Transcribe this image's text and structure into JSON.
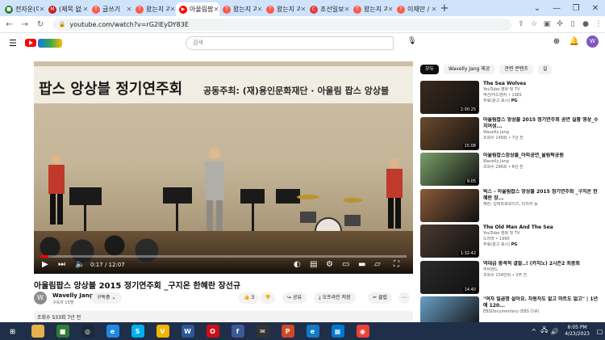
{
  "browser": {
    "tabs": [
      {
        "label": "전자운(이",
        "color": "#2e7d32",
        "glyph": "■"
      },
      {
        "label": "(제목 없음",
        "color": "#c5221f",
        "glyph": "M"
      },
      {
        "label": "글쓰기",
        "color": "#ff5a4a",
        "glyph": "T"
      },
      {
        "label": "왔는지 과",
        "color": "#ff5a4a",
        "glyph": "T"
      },
      {
        "label": "아울림팝",
        "color": "#ff0000",
        "glyph": "▶"
      },
      {
        "label": "왔는지 과",
        "color": "#ff5a4a",
        "glyph": "T"
      },
      {
        "label": "왔는지 과",
        "color": "#ff5a4a",
        "glyph": "T"
      },
      {
        "label": "조선일보",
        "color": "#e53935",
        "glyph": "C"
      },
      {
        "label": "왔는지 과",
        "color": "#ff5a4a",
        "glyph": "T"
      },
      {
        "label": "이재만 /",
        "color": "#ff5a4a",
        "glyph": "T"
      }
    ],
    "url": "youtube.com/watch?v=rG2lEyDY83E"
  },
  "youtube": {
    "search_placeholder": "검색",
    "avatar_letter": "W"
  },
  "player": {
    "banner_title": "팝스 앙상블 정기연주회",
    "banner_sub": "공동주최: (재)용인문화재단 · 아울림 팝스 앙상블",
    "time": "0:17 / 12:07",
    "progress": 0.023
  },
  "video": {
    "title": "아울림팝스 앙상블 2015 정기연주회 _구지온 한혜란 장선규",
    "channel": "Wavelly Jang",
    "channel_initial": "W",
    "subs": "구독자 15명",
    "subscribe": "구독중 ⌄",
    "likes": "3",
    "share": "공유",
    "offline": "오프라인 저장",
    "clip": "클립",
    "views": "조회수 533회  7년 전"
  },
  "sidebar": {
    "chips": [
      "모두",
      "Wavelly Jang 제공",
      "관련 콘텐츠",
      "실"
    ],
    "recs": [
      {
        "title": "The Sea Wolves",
        "channel": "YouTube 영화 및 TV",
        "meta": "액션/어드벤처 • 1981",
        "free": "무료(광고 표시)",
        "rating": "PG",
        "duration": "2:00:25",
        "thumb": "#3a2a1e"
      },
      {
        "title": "아울림팝스 앙상블 2015 정기연주회 공연 실황 영상_수지여성...",
        "channel": "Wavelly Jang",
        "meta": "조회수 149회 • 7년 전",
        "duration": "15:08",
        "thumb": "#6b4a2e"
      },
      {
        "title": "아울림팝스앙상블_아외공연_울림팍공원",
        "channel": "Wavelly Jang",
        "meta": "조회수 286회 • 8년 전",
        "duration": "9:05",
        "thumb": "#7aa06a"
      },
      {
        "title": "빅스 - 아울림팝스 앙상블 2015 정기연주회 _구지온 한혜란 장...",
        "channel": "해란, 일렉트로보이즈, 티아라 등",
        "meta": "",
        "duration": "",
        "thumb": "#8a5a3a"
      },
      {
        "title": "The Old Man And The Sea",
        "channel": "YouTube 영화 및 TV",
        "meta": "드라마 • 1990",
        "free": "무료(광고 표시)",
        "rating": "PG",
        "duration": "1:32:42",
        "thumb": "#4a3a30"
      },
      {
        "title": "역대급 충격적 결말..! (카지노) 2시즌2 최종회",
        "channel": "무비랜드",
        "meta": "조회수 154만회 • 3주 전",
        "duration": "14:40",
        "thumb": "#2a2a2a"
      },
      {
        "title": "\"여자 일곱명 살아요. 자동차도 없고 마트도 없고\" | 1년에 120...",
        "channel": "EBSDocumentary (EBS 다큐)",
        "meta": "",
        "duration": "",
        "thumb": "#6aa0c8"
      }
    ]
  },
  "taskbar": {
    "apps": [
      {
        "glyph": "⊞",
        "bg": "#1f2f4a",
        "fg": "#ffffff"
      },
      {
        "glyph": "",
        "bg": "#e8b04a",
        "fg": "#ffffff"
      },
      {
        "glyph": "■",
        "bg": "#2e7d32",
        "fg": "#ffffff"
      },
      {
        "glyph": "◎",
        "bg": "#1b2838",
        "fg": "#ffffff"
      },
      {
        "glyph": "e",
        "bg": "#1e88e5",
        "fg": "#ffffff"
      },
      {
        "glyph": "S",
        "bg": "#00aff0",
        "fg": "#ffffff"
      },
      {
        "glyph": "V",
        "bg": "#f4b400",
        "fg": "#ffffff"
      },
      {
        "glyph": "W",
        "bg": "#2b579a",
        "fg": "#ffffff"
      },
      {
        "glyph": "O",
        "bg": "#cc0f16",
        "fg": "#ffffff"
      },
      {
        "glyph": "f",
        "bg": "#3b5998",
        "fg": "#ffffff"
      },
      {
        "glyph": "✉",
        "bg": "#333333",
        "fg": "#ffffff"
      },
      {
        "glyph": "P",
        "bg": "#d24726",
        "fg": "#ffffff"
      },
      {
        "glyph": "e",
        "bg": "#0f7ac6",
        "fg": "#ffffff"
      },
      {
        "glyph": "▦",
        "bg": "#0078d4",
        "fg": "#ffffff"
      },
      {
        "glyph": "◉",
        "bg": "#ea4335",
        "fg": "#ffffff"
      }
    ],
    "time": "6:05 PM",
    "date": "4/23/2023"
  }
}
